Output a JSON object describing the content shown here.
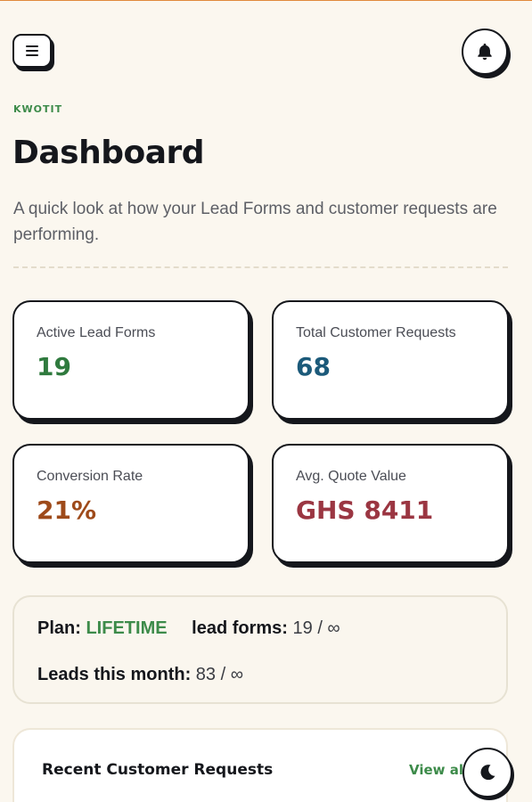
{
  "header": {
    "brand": "KWOTIT",
    "title": "Dashboard",
    "subtitle": "A quick look at how your Lead Forms and customer requests are performing."
  },
  "icons": {
    "menu": "menu-icon",
    "notifications": "bell-icon",
    "theme": "moon-icon"
  },
  "stats": [
    {
      "label": "Active Lead Forms",
      "value": "19",
      "color": "#2f7a3e"
    },
    {
      "label": "Total Customer Requests",
      "value": "68",
      "color": "#1c5a7a"
    },
    {
      "label": "Conversion Rate",
      "value": "21%",
      "color": "#9e4a1a"
    },
    {
      "label": "Avg. Quote Value",
      "value": "GHS 8411",
      "color": "#9b3642"
    }
  ],
  "plan": {
    "plan_label": "Plan:",
    "plan_value": "LIFETIME",
    "forms_label": "lead forms:",
    "forms_value": "19 / ∞",
    "leads_label": "Leads this month:",
    "leads_value": "83 / ∞"
  },
  "recent": {
    "title": "Recent Customer Requests",
    "view_all": "View all"
  }
}
